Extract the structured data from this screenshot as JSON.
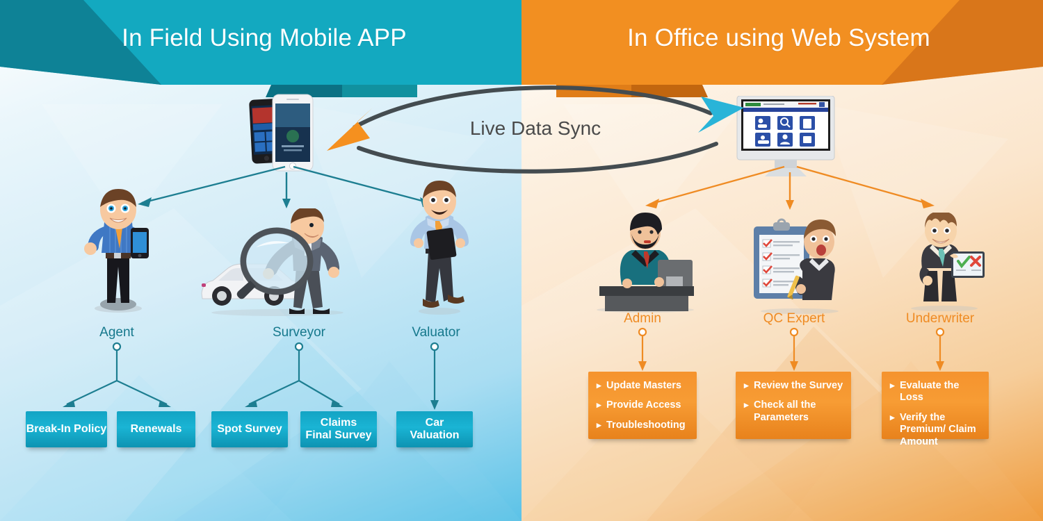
{
  "headers": {
    "left": "In Field Using Mobile APP",
    "right": "In Office using Web System"
  },
  "center": {
    "sync_label": "Live Data Sync",
    "arrow_right_color": "#29b4d8",
    "arrow_left_color": "#f5901f",
    "curve_color": "#444c50"
  },
  "theme": {
    "teal": "#13a4c4",
    "teal_dark": "#0f8fa8",
    "teal_banner": "#13a9c0",
    "teal_banner_dark": "#0e8296",
    "orange": "#f5932e",
    "orange_banner": "#f28f21",
    "orange_banner_dark": "#d9761a",
    "label_left": "#15788c",
    "label_right": "#ef8b23"
  },
  "field": {
    "device_name": "smartphones",
    "roles": [
      {
        "id": "agent",
        "label": "Agent",
        "character": "agent-with-phone-thumbs-up",
        "boxes": [
          {
            "lines": [
              "Break-In Policy"
            ]
          },
          {
            "lines": [
              "Renewals"
            ]
          }
        ]
      },
      {
        "id": "surveyor",
        "label": "Surveyor",
        "character": "surveyor-magnifying-glass-car",
        "boxes": [
          {
            "lines": [
              "Spot Survey"
            ]
          },
          {
            "lines": [
              "Claims",
              "Final Survey"
            ]
          }
        ]
      },
      {
        "id": "valuator",
        "label": "Valuator",
        "character": "valuator-with-tablet",
        "boxes": [
          {
            "lines": [
              "Car",
              "Valuation"
            ]
          }
        ]
      }
    ]
  },
  "office": {
    "device_name": "desktop-monitor",
    "roles": [
      {
        "id": "admin",
        "label": "Admin",
        "character": "admin-at-desk",
        "tasks": [
          "Update Masters",
          "Provide Access",
          "Troubleshooting"
        ]
      },
      {
        "id": "qc-expert",
        "label": "QC Expert",
        "character": "qc-expert-with-checklist",
        "tasks": [
          "Review the Survey",
          "Check all the Parameters"
        ]
      },
      {
        "id": "underwriter",
        "label": "Underwriter",
        "character": "underwriter-with-tablet",
        "tasks": [
          "Evaluate the Loss",
          "Verify the Premium/ Claim Amount"
        ]
      }
    ]
  }
}
